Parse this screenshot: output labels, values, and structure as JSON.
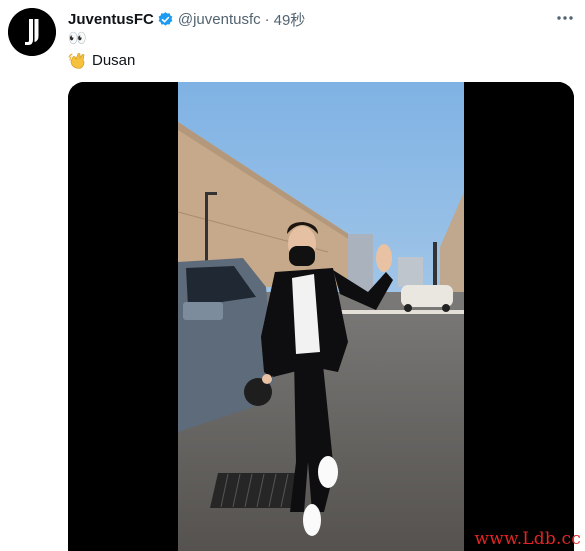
{
  "tweet": {
    "display_name": "JuventusFC",
    "handle": "@juventusfc",
    "separator": "·",
    "time": "49秒",
    "line1": "👀",
    "line2_emoji": "👋",
    "line2_text": "Dusan"
  },
  "icons": {
    "avatar": "juventus-j-logo",
    "verified": "verified-badge-icon",
    "more": "more-horizontal-icon"
  },
  "colors": {
    "verified": "#1d9bf0",
    "secondary_text": "#536471",
    "watermark": "#e32525"
  },
  "watermark": "www.Ldb.cc"
}
